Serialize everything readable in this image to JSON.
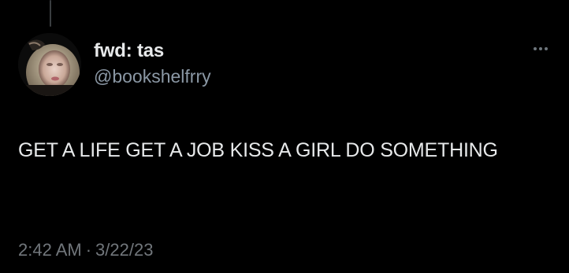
{
  "user": {
    "display_name": "fwd: tas",
    "handle": "@bookshelfrry",
    "avatar_icon": "profile-photo"
  },
  "tweet": {
    "text": "GET A LIFE GET A JOB KISS A GIRL DO SOMETHING"
  },
  "meta": {
    "time": "2:42 AM",
    "separator": "·",
    "date": "3/22/23"
  },
  "actions": {
    "more_icon": "ellipsis-icon"
  },
  "colors": {
    "background": "#000000",
    "primary_text": "#e7e9ea",
    "secondary_text": "#71767b",
    "thread_line": "#3a3d40"
  }
}
